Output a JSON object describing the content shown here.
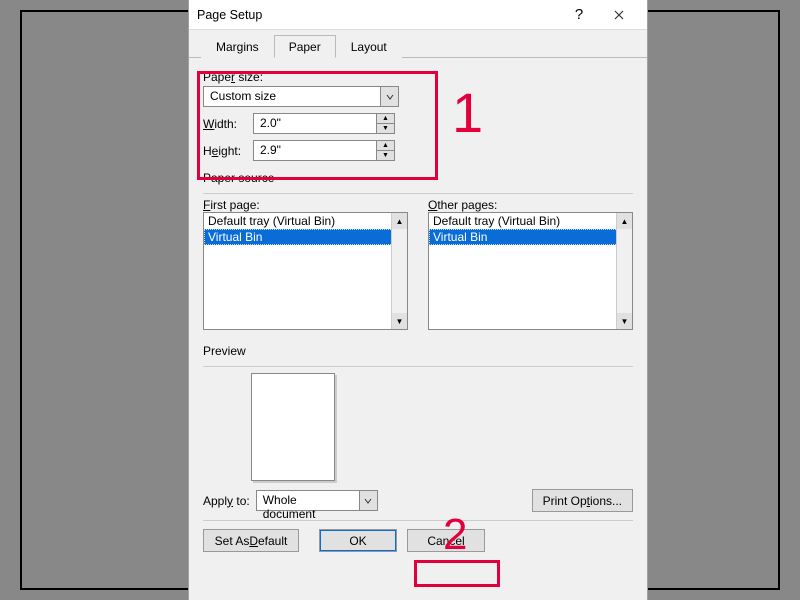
{
  "title": "Page Setup",
  "tabs": {
    "margins": "Margins",
    "paper": "Paper",
    "layout": "Layout"
  },
  "paper_size": {
    "label": "Paper size:",
    "value": "Custom size",
    "width_label": "Width:",
    "width_value": "2.0\"",
    "height_label": "Height:",
    "height_value": "2.9\""
  },
  "paper_source": {
    "label": "Paper source",
    "first_label": "First page:",
    "other_label": "Other pages:",
    "options": {
      "default": "Default tray (Virtual Bin)",
      "virtual": "Virtual Bin"
    }
  },
  "preview_label": "Preview",
  "apply_to": {
    "label": "Apply to:",
    "value": "Whole document"
  },
  "buttons": {
    "print_options": "Print Options...",
    "set_default": "Set As Default",
    "ok": "OK",
    "cancel": "Cancel"
  },
  "annotations": {
    "one": "1",
    "two": "2"
  }
}
